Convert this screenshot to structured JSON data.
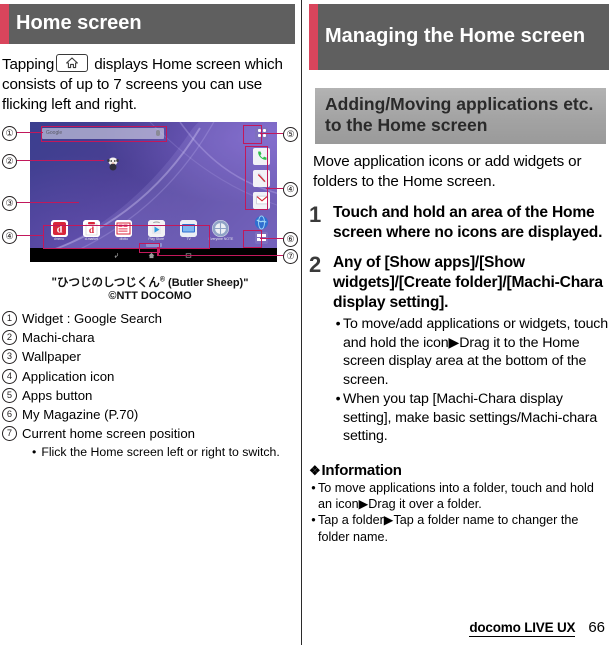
{
  "left": {
    "chapter_title": "Home screen",
    "intro": "Tapping  displays Home screen which consists of up to 7 screens you can use flicking left and right.",
    "intro_before": "Tapping",
    "intro_after": "displays Home screen which consists of up to 7 screens you can use flicking left and right.",
    "screenshot": {
      "search_widget_text": "Google",
      "dock": [
        {
          "label": "dmenu",
          "icon": "dmenu-icon"
        },
        {
          "label": "d-market",
          "icon": "dmarket-icon"
        },
        {
          "label": "dfotto",
          "icon": "dphoto-icon"
        },
        {
          "label": "Play Store",
          "icon": "play-store-icon"
        },
        {
          "label": "TV",
          "icon": "tv-icon"
        },
        {
          "label": "Everyone NOTE",
          "icon": "app-icon"
        }
      ],
      "side_shortcuts": [
        "phone-icon",
        "contacts-icon",
        "mail-icon",
        "browser-icon"
      ],
      "apps_button": "apps-button-icon",
      "my_magazine": "my-magazine-icon",
      "nav": [
        "back-icon",
        "home-icon",
        "recents-icon"
      ]
    },
    "caption_line1_jp": "\"ひつじのしつじくん",
    "caption_line1_sup": "®",
    "caption_line1_en": " (Butler Sheep)\"",
    "caption_line2": "©NTT DOCOMO",
    "legend": [
      {
        "num": "①",
        "text": "Widget : Google Search"
      },
      {
        "num": "②",
        "text": "Machi-chara"
      },
      {
        "num": "③",
        "text": "Wallpaper"
      },
      {
        "num": "④",
        "text": "Application icon"
      },
      {
        "num": "⑤",
        "text": "Apps button"
      },
      {
        "num": "⑥",
        "text": "My Magazine (P.70)"
      },
      {
        "num": "⑦",
        "text": "Current home screen position"
      }
    ],
    "legend_subnote_bullet": "•",
    "legend_subnote": "Flick the Home screen left or right to switch."
  },
  "right": {
    "chapter_title": "Managing the Home screen",
    "sub_head": "Adding/Moving applications etc. to the Home screen",
    "intro": "Move application icons or add widgets or folders to the Home screen.",
    "steps": [
      {
        "num": "1",
        "title": "Touch and hold an area of the Home screen where no icons are displayed.",
        "bullets": []
      },
      {
        "num": "2",
        "title": "Any of [Show apps]/[Show widgets]/[Create folder]/[Machi-Chara display setting].",
        "bullets": [
          "To move/add applications or widgets, touch and hold the icon▶Drag it to the Home screen display area at the bottom of the screen.",
          "When you tap [Machi-Chara display setting], make basic settings/Machi-chara setting."
        ]
      }
    ],
    "information_head": "Information",
    "information_diamond": "❖",
    "information_bullets": [
      "To move applications into a folder, touch and hold an icon▶Drag it over a folder.",
      "Tap a folder▶Tap a folder name to changer the folder name."
    ]
  },
  "footer": {
    "brand": "docomo LIVE UX",
    "page": "66"
  },
  "colors": {
    "accent_red": "#d9455c",
    "header_gray": "#5f5f5f",
    "subhead_gray": "#a3a3a3",
    "callout_pink": "#c2185b"
  }
}
